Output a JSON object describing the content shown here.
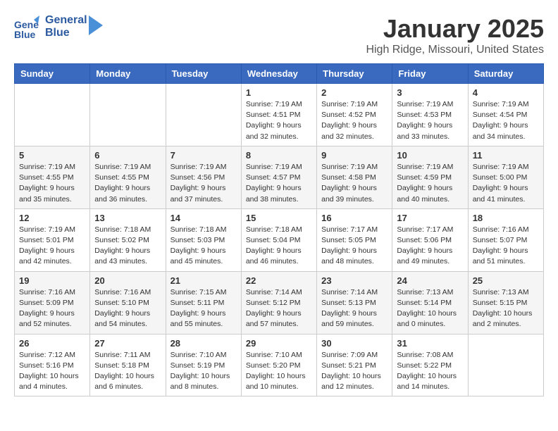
{
  "header": {
    "logo_line1": "General",
    "logo_line2": "Blue",
    "month": "January 2025",
    "location": "High Ridge, Missouri, United States"
  },
  "weekdays": [
    "Sunday",
    "Monday",
    "Tuesday",
    "Wednesday",
    "Thursday",
    "Friday",
    "Saturday"
  ],
  "weeks": [
    [
      {
        "day": "",
        "info": ""
      },
      {
        "day": "",
        "info": ""
      },
      {
        "day": "",
        "info": ""
      },
      {
        "day": "1",
        "info": "Sunrise: 7:19 AM\nSunset: 4:51 PM\nDaylight: 9 hours\nand 32 minutes."
      },
      {
        "day": "2",
        "info": "Sunrise: 7:19 AM\nSunset: 4:52 PM\nDaylight: 9 hours\nand 32 minutes."
      },
      {
        "day": "3",
        "info": "Sunrise: 7:19 AM\nSunset: 4:53 PM\nDaylight: 9 hours\nand 33 minutes."
      },
      {
        "day": "4",
        "info": "Sunrise: 7:19 AM\nSunset: 4:54 PM\nDaylight: 9 hours\nand 34 minutes."
      }
    ],
    [
      {
        "day": "5",
        "info": "Sunrise: 7:19 AM\nSunset: 4:55 PM\nDaylight: 9 hours\nand 35 minutes."
      },
      {
        "day": "6",
        "info": "Sunrise: 7:19 AM\nSunset: 4:55 PM\nDaylight: 9 hours\nand 36 minutes."
      },
      {
        "day": "7",
        "info": "Sunrise: 7:19 AM\nSunset: 4:56 PM\nDaylight: 9 hours\nand 37 minutes."
      },
      {
        "day": "8",
        "info": "Sunrise: 7:19 AM\nSunset: 4:57 PM\nDaylight: 9 hours\nand 38 minutes."
      },
      {
        "day": "9",
        "info": "Sunrise: 7:19 AM\nSunset: 4:58 PM\nDaylight: 9 hours\nand 39 minutes."
      },
      {
        "day": "10",
        "info": "Sunrise: 7:19 AM\nSunset: 4:59 PM\nDaylight: 9 hours\nand 40 minutes."
      },
      {
        "day": "11",
        "info": "Sunrise: 7:19 AM\nSunset: 5:00 PM\nDaylight: 9 hours\nand 41 minutes."
      }
    ],
    [
      {
        "day": "12",
        "info": "Sunrise: 7:19 AM\nSunset: 5:01 PM\nDaylight: 9 hours\nand 42 minutes."
      },
      {
        "day": "13",
        "info": "Sunrise: 7:18 AM\nSunset: 5:02 PM\nDaylight: 9 hours\nand 43 minutes."
      },
      {
        "day": "14",
        "info": "Sunrise: 7:18 AM\nSunset: 5:03 PM\nDaylight: 9 hours\nand 45 minutes."
      },
      {
        "day": "15",
        "info": "Sunrise: 7:18 AM\nSunset: 5:04 PM\nDaylight: 9 hours\nand 46 minutes."
      },
      {
        "day": "16",
        "info": "Sunrise: 7:17 AM\nSunset: 5:05 PM\nDaylight: 9 hours\nand 48 minutes."
      },
      {
        "day": "17",
        "info": "Sunrise: 7:17 AM\nSunset: 5:06 PM\nDaylight: 9 hours\nand 49 minutes."
      },
      {
        "day": "18",
        "info": "Sunrise: 7:16 AM\nSunset: 5:07 PM\nDaylight: 9 hours\nand 51 minutes."
      }
    ],
    [
      {
        "day": "19",
        "info": "Sunrise: 7:16 AM\nSunset: 5:09 PM\nDaylight: 9 hours\nand 52 minutes."
      },
      {
        "day": "20",
        "info": "Sunrise: 7:16 AM\nSunset: 5:10 PM\nDaylight: 9 hours\nand 54 minutes."
      },
      {
        "day": "21",
        "info": "Sunrise: 7:15 AM\nSunset: 5:11 PM\nDaylight: 9 hours\nand 55 minutes."
      },
      {
        "day": "22",
        "info": "Sunrise: 7:14 AM\nSunset: 5:12 PM\nDaylight: 9 hours\nand 57 minutes."
      },
      {
        "day": "23",
        "info": "Sunrise: 7:14 AM\nSunset: 5:13 PM\nDaylight: 9 hours\nand 59 minutes."
      },
      {
        "day": "24",
        "info": "Sunrise: 7:13 AM\nSunset: 5:14 PM\nDaylight: 10 hours\nand 0 minutes."
      },
      {
        "day": "25",
        "info": "Sunrise: 7:13 AM\nSunset: 5:15 PM\nDaylight: 10 hours\nand 2 minutes."
      }
    ],
    [
      {
        "day": "26",
        "info": "Sunrise: 7:12 AM\nSunset: 5:16 PM\nDaylight: 10 hours\nand 4 minutes."
      },
      {
        "day": "27",
        "info": "Sunrise: 7:11 AM\nSunset: 5:18 PM\nDaylight: 10 hours\nand 6 minutes."
      },
      {
        "day": "28",
        "info": "Sunrise: 7:10 AM\nSunset: 5:19 PM\nDaylight: 10 hours\nand 8 minutes."
      },
      {
        "day": "29",
        "info": "Sunrise: 7:10 AM\nSunset: 5:20 PM\nDaylight: 10 hours\nand 10 minutes."
      },
      {
        "day": "30",
        "info": "Sunrise: 7:09 AM\nSunset: 5:21 PM\nDaylight: 10 hours\nand 12 minutes."
      },
      {
        "day": "31",
        "info": "Sunrise: 7:08 AM\nSunset: 5:22 PM\nDaylight: 10 hours\nand 14 minutes."
      },
      {
        "day": "",
        "info": ""
      }
    ]
  ]
}
